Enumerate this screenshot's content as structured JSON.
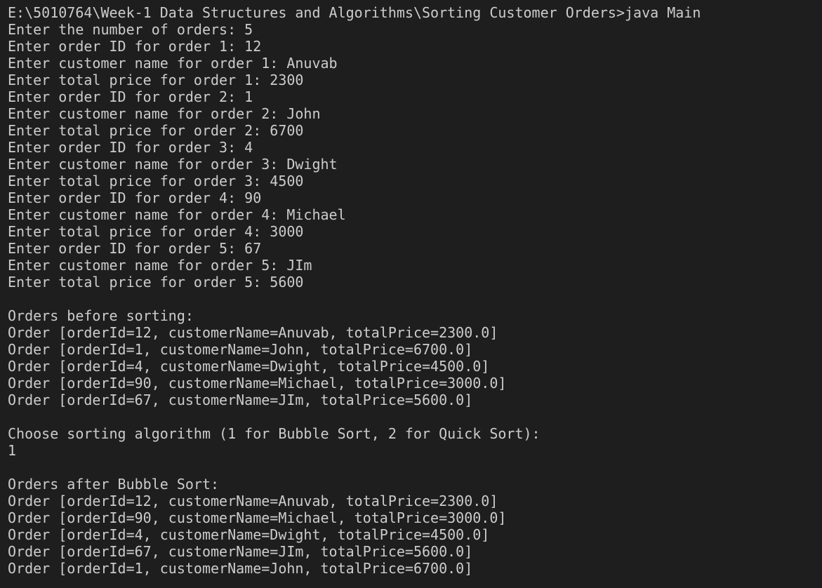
{
  "terminal": {
    "lines": [
      "E:\\5010764\\Week-1 Data Structures and Algorithms\\Sorting Customer Orders>java Main",
      "Enter the number of orders: 5",
      "Enter order ID for order 1: 12",
      "Enter customer name for order 1: Anuvab",
      "Enter total price for order 1: 2300",
      "Enter order ID for order 2: 1",
      "Enter customer name for order 2: John",
      "Enter total price for order 2: 6700",
      "Enter order ID for order 3: 4",
      "Enter customer name for order 3: Dwight",
      "Enter total price for order 3: 4500",
      "Enter order ID for order 4: 90",
      "Enter customer name for order 4: Michael",
      "Enter total price for order 4: 3000",
      "Enter order ID for order 5: 67",
      "Enter customer name for order 5: JIm",
      "Enter total price for order 5: 5600",
      "",
      "Orders before sorting:",
      "Order [orderId=12, customerName=Anuvab, totalPrice=2300.0]",
      "Order [orderId=1, customerName=John, totalPrice=6700.0]",
      "Order [orderId=4, customerName=Dwight, totalPrice=4500.0]",
      "Order [orderId=90, customerName=Michael, totalPrice=3000.0]",
      "Order [orderId=67, customerName=JIm, totalPrice=5600.0]",
      "",
      "Choose sorting algorithm (1 for Bubble Sort, 2 for Quick Sort):",
      "1",
      "",
      "Orders after Bubble Sort:",
      "Order [orderId=12, customerName=Anuvab, totalPrice=2300.0]",
      "Order [orderId=90, customerName=Michael, totalPrice=3000.0]",
      "Order [orderId=4, customerName=Dwight, totalPrice=4500.0]",
      "Order [orderId=67, customerName=JIm, totalPrice=5600.0]",
      "Order [orderId=1, customerName=John, totalPrice=6700.0]"
    ]
  }
}
